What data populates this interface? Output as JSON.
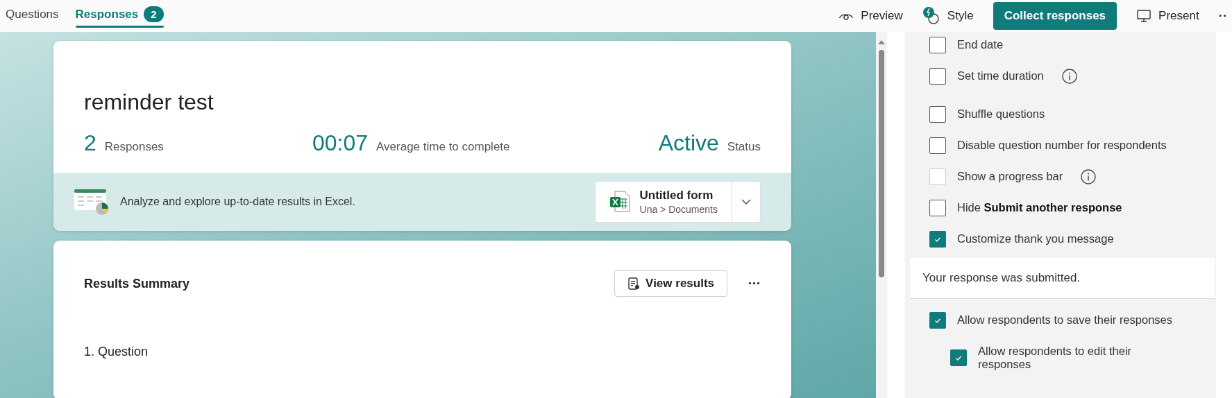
{
  "tabs": [
    {
      "label": "Questions",
      "selected": false
    },
    {
      "label": "Responses",
      "selected": true,
      "badge": "2"
    }
  ],
  "toolbar": {
    "preview": "Preview",
    "style": "Style",
    "collect": "Collect responses",
    "present": "Present",
    "more": "··"
  },
  "summary": {
    "title": "reminder test",
    "stats": [
      {
        "value": "2",
        "label": "Responses"
      },
      {
        "value": "00:07",
        "label": "Average time to complete"
      },
      {
        "value": "Active",
        "label": "Status"
      }
    ],
    "excel_text": "Analyze and explore up-to-date results in Excel.",
    "file_name": "Untitled form",
    "file_path": "Una > Documents"
  },
  "results": {
    "title": "Results Summary",
    "view_button": "View results",
    "more": "···",
    "questions": [
      "1.  Question"
    ]
  },
  "settings": [
    {
      "label": "End date",
      "checked": false
    },
    {
      "label": "Set time duration",
      "checked": false,
      "info": true
    },
    {
      "label": "Shuffle questions",
      "checked": false
    },
    {
      "label": "Disable question number for respondents",
      "checked": false
    },
    {
      "label": "Show a progress bar",
      "checked": false,
      "disabled": true,
      "info": true
    },
    {
      "label": "Hide **Submit another response**",
      "checked": false
    },
    {
      "label": "Customize thank you message",
      "checked": true,
      "message": "Your response was submitted."
    },
    {
      "label": "Allow respondents to save their responses",
      "checked": true,
      "children": [
        {
          "label": "Allow respondents to edit their responses",
          "checked": true
        }
      ]
    }
  ]
}
